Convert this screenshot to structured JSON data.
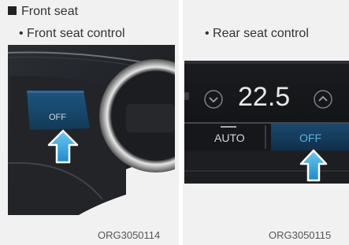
{
  "section": {
    "title": "Front seat"
  },
  "left_panel": {
    "bullet": "• Front seat control",
    "button_label": "OFF",
    "figure_code": "ORG3050114"
  },
  "right_panel": {
    "bullet": "• Rear seat control",
    "temperature": "22.5",
    "auto_label": "AUTO",
    "off_label": "OFF",
    "figure_code": "ORG3050115"
  },
  "colors": {
    "panel_bg": "#f1f1f1",
    "off_button_blue": "#1a4a6e",
    "arrow_fill": "#2a9fd8",
    "display_text": "#e8e8e8",
    "off_text_blue": "#5ab0e0"
  },
  "icons": {
    "down_chevron": "chevron-down-icon",
    "up_chevron": "chevron-up-icon",
    "pointer": "arrow-up-icon"
  }
}
